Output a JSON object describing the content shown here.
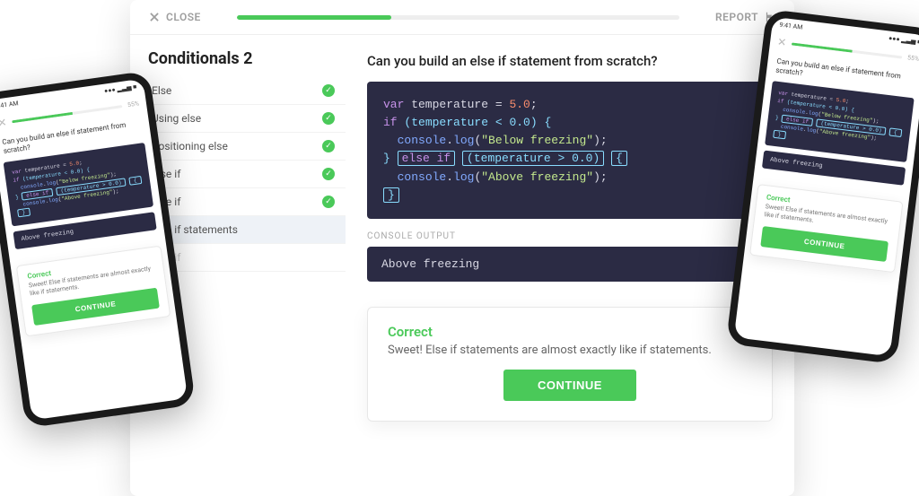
{
  "topbar": {
    "close_label": "CLOSE",
    "report_label": "REPORT",
    "progress_pct": 35
  },
  "sidebar": {
    "title": "Conditionals 2",
    "steps": [
      {
        "label": "Else",
        "done": true
      },
      {
        "label": "Using else",
        "done": true
      },
      {
        "label": "Positioning else",
        "done": true
      },
      {
        "label": "Else if",
        "done": true
      },
      {
        "label": "Else if",
        "done": true
      },
      {
        "label": "Else if statements",
        "done": false,
        "active": true
      },
      {
        "label": "Else if",
        "done": false,
        "dim": true
      }
    ]
  },
  "main": {
    "prompt": "Can you build an else if statement from scratch?",
    "code_lines": [
      {
        "t": "var ",
        "c": "kw"
      },
      {
        "t": "temperature ",
        "c": ""
      },
      {
        "t": "= ",
        "c": ""
      },
      {
        "t": "5.0",
        "c": "num"
      },
      {
        "t": ";",
        "c": ""
      }
    ],
    "console_label": "CONSOLE OUTPUT",
    "console_output": "Above freezing",
    "feedback_title": "Correct",
    "feedback_body": "Sweet! Else if statements are almost exactly like if statements.",
    "continue_label": "CONTINUE"
  },
  "phone": {
    "status_time": "9:41 AM",
    "progress_pct": 55,
    "progress_label": "55%",
    "prompt": "Can you build an else if statement from scratch?",
    "console_output": "Above freezing",
    "feedback_title": "Correct",
    "feedback_body": "Sweet! Else if statements are almost exactly like if statements.",
    "continue_label": "CONTINUE"
  },
  "code": {
    "var_decl_kw": "var",
    "var_name": "temperature",
    "var_val": "5.0",
    "if_kw": "if",
    "cond1": "(temperature < 0.0)",
    "log_fn": "console",
    "log_m": "log",
    "str1": "\"Below freezing\"",
    "else_kw": "else",
    "elseif_kw": "else if",
    "cond2": "(temperature > 0.0)",
    "str2": "\"Above freezing\""
  }
}
